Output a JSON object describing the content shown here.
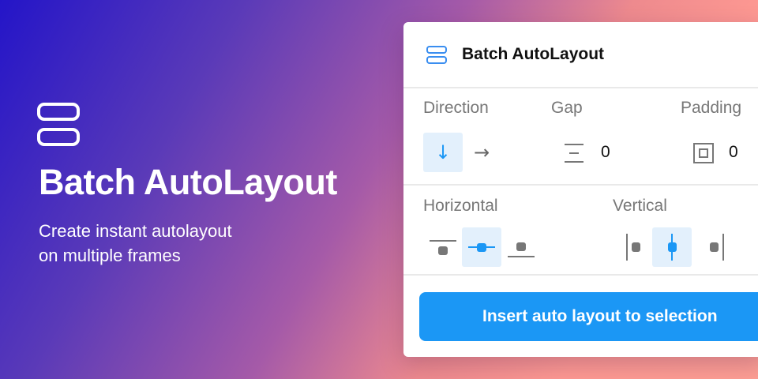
{
  "hero": {
    "title": "Batch AutoLayout",
    "subtitle_line1": "Create instant autolayout",
    "subtitle_line2": "on multiple frames"
  },
  "panel": {
    "title": "Batch AutoLayout",
    "direction": {
      "label": "Direction",
      "down_glyph": "↓",
      "right_glyph": "→",
      "selected": "down"
    },
    "gap": {
      "label": "Gap",
      "value": "0"
    },
    "padding": {
      "label": "Padding",
      "value": "0"
    },
    "horizontal": {
      "label": "Horizontal",
      "selected": "center"
    },
    "vertical": {
      "label": "Vertical",
      "selected": "center"
    },
    "insert_button": "Insert auto layout to selection"
  },
  "colors": {
    "accent": "#1b97f5",
    "selected_tile": "#e3f0fc",
    "icon_active": "#1b97f5",
    "icon_inactive": "#777777"
  }
}
